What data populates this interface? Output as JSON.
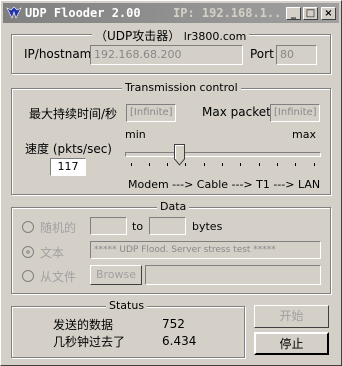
{
  "window": {
    "title": "UDP Flooder 2.00",
    "title_ip": "IP: 192.168.1...",
    "min_label": "_",
    "max_label": "□",
    "close_label": "×"
  },
  "target": {
    "legend_left": "（UDP攻击器）",
    "legend_right": "lr3800.com",
    "host_label": "IP/hostname",
    "host_value": "192.168.68.200",
    "port_label": "Port",
    "port_value": "80"
  },
  "transmission": {
    "legend": "Transmission control",
    "max_time_label": "最大持续时间/秒",
    "max_time_value": "[Infinite]",
    "max_packets_label": "Max packets",
    "max_packets_value": "[Infinite]",
    "speed_label": "速度 (pkts/sec)",
    "speed_value": "117",
    "min_label": "min",
    "max_label": "max",
    "scale_text": "Modem ---> Cable ---> T1 ---> LAN",
    "slider_level": 0.27
  },
  "data": {
    "legend": "Data",
    "random_label": "随机的",
    "to_label": "to",
    "bytes_label": "bytes",
    "text_label": "文本",
    "text_value": "***** UDP Flood. Server stress test *****",
    "file_label": "从文件",
    "browse_label": "Browse",
    "selected": "text"
  },
  "status": {
    "legend": "Status",
    "sent_label": "发送的数据",
    "sent_value": "752",
    "elapsed_label": "几秒钟过去了",
    "elapsed_value": "6.434"
  },
  "buttons": {
    "start_label": "开始",
    "stop_label": "停止"
  }
}
